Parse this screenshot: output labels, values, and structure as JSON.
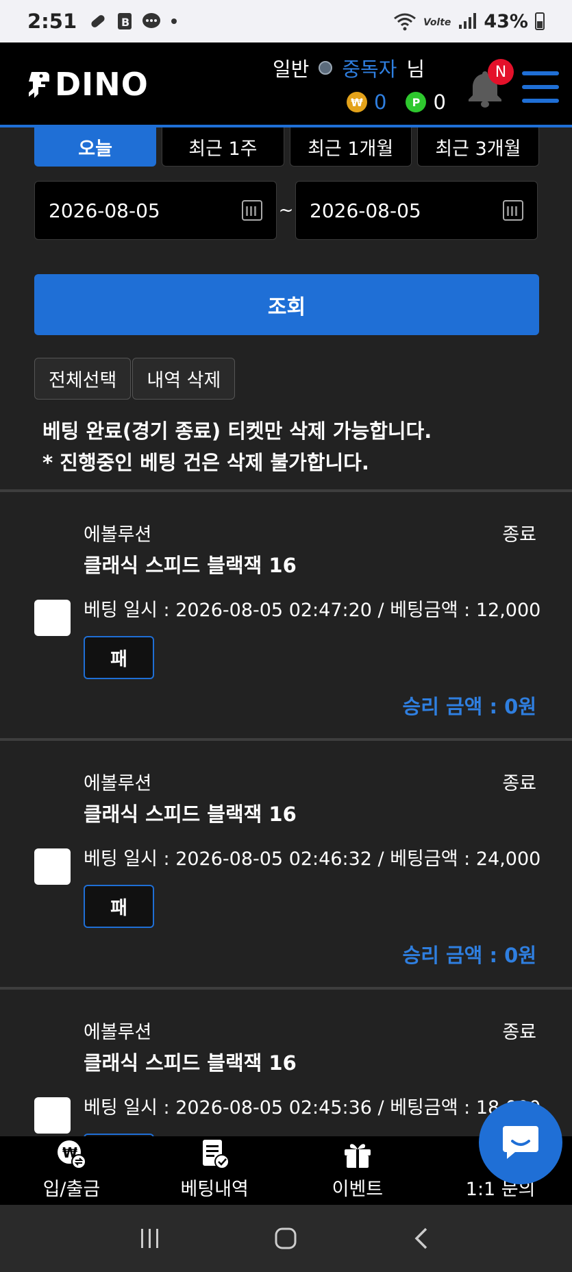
{
  "status_bar": {
    "time": "2:51",
    "battery": "43%",
    "icons": [
      "link-icon",
      "b-app-icon",
      "chat-bubble-icon",
      "dot-icon",
      "wifi-icon",
      "volte-icon",
      "signal-icon",
      "battery-icon"
    ]
  },
  "header": {
    "logo": "DINO",
    "user_level": "일반",
    "nickname": "중독자",
    "honorific": "님",
    "money": "0",
    "points": "0",
    "notification_badge": "N",
    "coin_won_symbol": "₩",
    "coin_point_symbol": "P"
  },
  "period_tabs": [
    {
      "label": "오늘",
      "active": true
    },
    {
      "label": "최근 1주",
      "active": false
    },
    {
      "label": "최근 1개월",
      "active": false
    },
    {
      "label": "최근 3개월",
      "active": false
    }
  ],
  "date_range": {
    "start": "2026-08-05",
    "separator": "~",
    "end": "2026-08-05"
  },
  "search_button": "조회",
  "actions": {
    "select_all": "전체선택",
    "delete": "내역 삭제"
  },
  "notice": [
    "베팅 완료(경기 종료) 티켓만 삭제 가능합니다.",
    "* 진행중인 베팅 건은 삭제 불가합니다."
  ],
  "bets": [
    {
      "category": "에볼루션",
      "status": "종료",
      "title": "클래식 스피드 블랙잭 16",
      "info": "베팅 일시 : 2026-08-05 02:47:20 / 베팅금액 : 12,000",
      "result": "패",
      "win": "승리 금액 : 0원"
    },
    {
      "category": "에볼루션",
      "status": "종료",
      "title": "클래식 스피드 블랙잭 16",
      "info": "베팅 일시 : 2026-08-05 02:46:32 / 베팅금액 : 24,000",
      "result": "패",
      "win": "승리 금액 : 0원"
    },
    {
      "category": "에볼루션",
      "status": "종료",
      "title": "클래식 스피드 블랙잭 16",
      "info": "베팅 일시 : 2026-08-05 02:45:36 / 베팅금액 : 18,000",
      "result": "",
      "win": ""
    }
  ],
  "bottom_nav": [
    {
      "label": "입/출금",
      "icon": "deposit-withdraw-icon"
    },
    {
      "label": "베팅내역",
      "icon": "betting-history-icon"
    },
    {
      "label": "이벤트",
      "icon": "gift-icon"
    },
    {
      "label": "1:1 문의",
      "icon": "inquiry-icon"
    }
  ],
  "colors": {
    "accent": "#1f6fd6",
    "link": "#2f7fe0",
    "header_bg": "#000000",
    "page_bg": "#222222",
    "badge": "#e4112a"
  }
}
